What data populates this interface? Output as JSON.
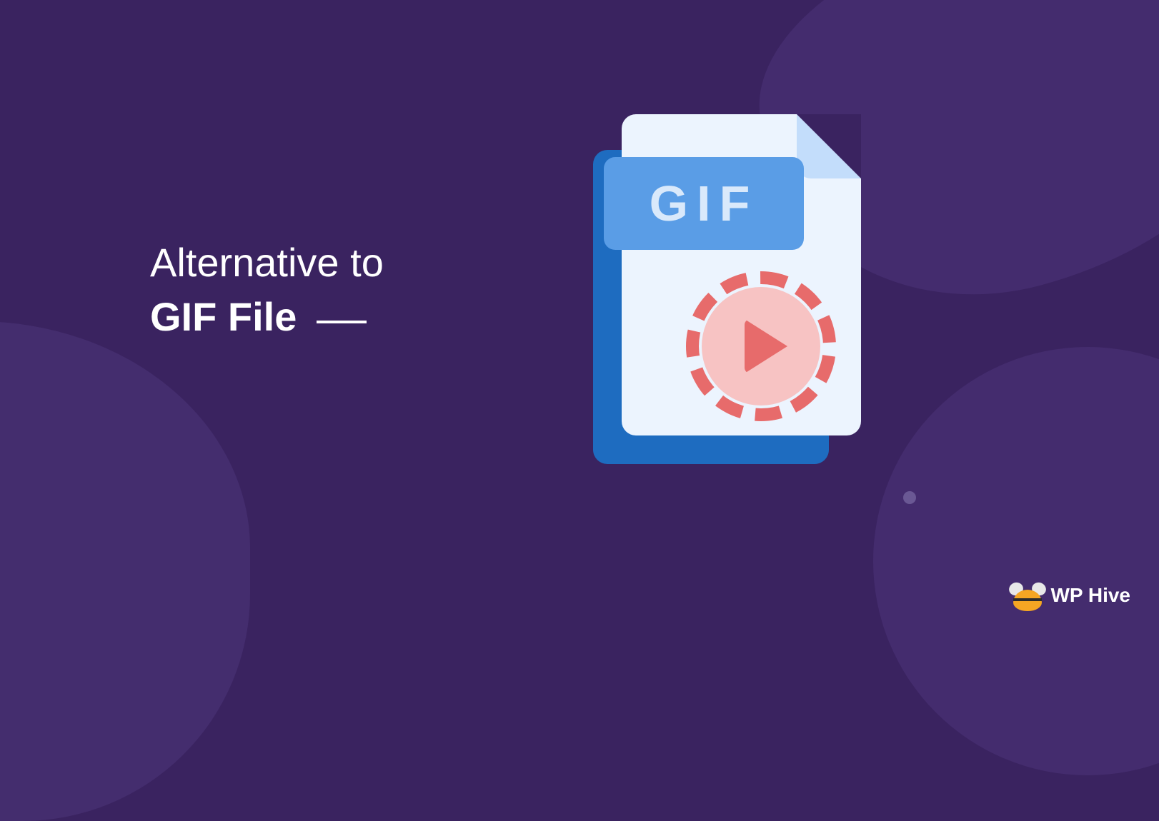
{
  "headline": {
    "line1": "Alternative to",
    "line2": "GIF File"
  },
  "file_icon": {
    "label": "GIF"
  },
  "brand": {
    "name": "WP Hive"
  },
  "colors": {
    "background": "#3a2360",
    "shape": "#442c6e",
    "file_back": "#1e6cc0",
    "file_front": "#ecf4fe",
    "gif_label_bg": "#5a9de6",
    "play_accent": "#e76b6b",
    "play_fill": "#f7c3c3",
    "logo_accent": "#f5a623"
  }
}
